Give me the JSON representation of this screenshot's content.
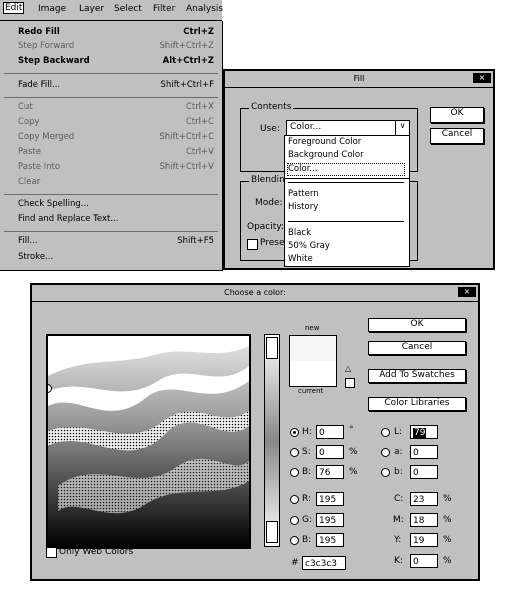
{
  "menubar": {
    "items": [
      "Edit",
      "Image",
      "Layer",
      "Select",
      "Filter",
      "Analysis"
    ]
  },
  "edit_menu": {
    "items": [
      {
        "label": "Redo Fill",
        "shortcut": "Ctrl+Z"
      },
      {
        "label": "Step Forward",
        "shortcut": "Shift+Ctrl+Z"
      },
      {
        "label": "Step Backward",
        "shortcut": "Alt+Ctrl+Z"
      },
      {
        "label": "Fade Fill...",
        "shortcut": "Shift+Ctrl+F"
      },
      {
        "label": "Cut",
        "shortcut": "Ctrl+X"
      },
      {
        "label": "Copy",
        "shortcut": "Ctrl+C"
      },
      {
        "label": "Copy Merged",
        "shortcut": "Shift+Ctrl+C"
      },
      {
        "label": "Paste",
        "shortcut": "Ctrl+V"
      },
      {
        "label": "Paste Into",
        "shortcut": "Shift+Ctrl+V"
      },
      {
        "label": "Clear",
        "shortcut": ""
      },
      {
        "label": "Check Spelling...",
        "shortcut": ""
      },
      {
        "label": "Find and Replace Text...",
        "shortcut": ""
      },
      {
        "label": "Fill...",
        "shortcut": "Shift+F5"
      },
      {
        "label": "Stroke...",
        "shortcut": ""
      }
    ]
  },
  "fill_dialog": {
    "title": "Fill",
    "close": "×",
    "contents_label": "Contents",
    "use_label": "Use:",
    "use_value": "Color...",
    "use_options": [
      "Foreground Color",
      "Background Color",
      "Color...",
      "Pattern",
      "History",
      "Black",
      "50% Gray",
      "White"
    ],
    "blending_label": "Blendin",
    "mode_label": "Mode:",
    "opacity_label": "Opacity:",
    "preserve_label": "Preser",
    "ok": "OK",
    "cancel": "Cancel"
  },
  "color_picker": {
    "title": "Choose a color:",
    "close": "×",
    "new_label": "new",
    "current_label": "current",
    "buttons": {
      "ok": "OK",
      "cancel": "Cancel",
      "add_swatches": "Add To Swatches",
      "color_libraries": "Color Libraries"
    },
    "only_web_label": "Only Web Colors",
    "hsb": [
      {
        "label": "H:",
        "value": "0",
        "unit": "°"
      },
      {
        "label": "S:",
        "value": "0",
        "unit": "%"
      },
      {
        "label": "B:",
        "value": "76",
        "unit": "%"
      }
    ],
    "rgb": [
      {
        "label": "R:",
        "value": "195"
      },
      {
        "label": "G:",
        "value": "195"
      },
      {
        "label": "B:",
        "value": "195"
      }
    ],
    "lab": [
      {
        "label": "L:",
        "value": "79"
      },
      {
        "label": "a:",
        "value": "0"
      },
      {
        "label": "b:",
        "value": "0"
      }
    ],
    "cmyk": [
      {
        "label": "C:",
        "value": "23",
        "unit": "%"
      },
      {
        "label": "M:",
        "value": "18",
        "unit": "%"
      },
      {
        "label": "Y:",
        "value": "19",
        "unit": "%"
      },
      {
        "label": "K:",
        "value": "0",
        "unit": "%"
      }
    ],
    "hex_label": "#",
    "hex_value": "c3c3c3",
    "new_color": "#f6f6f6",
    "current_color": "#ffffff"
  }
}
